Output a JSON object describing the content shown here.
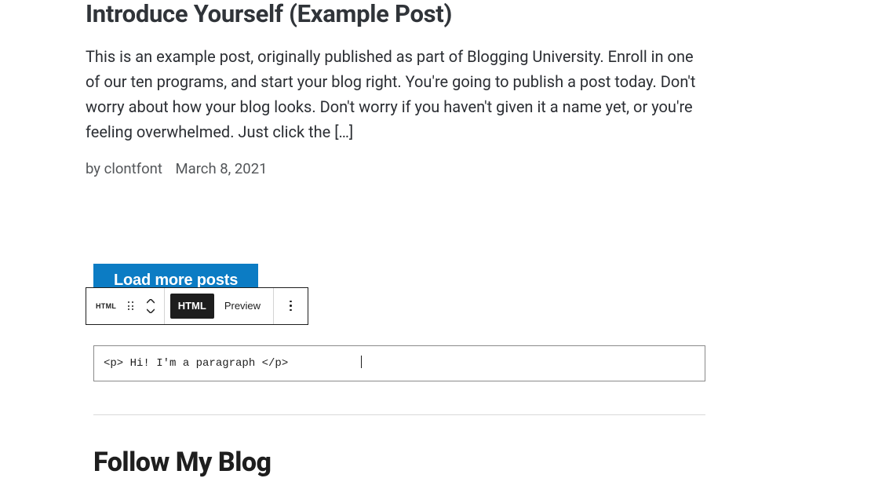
{
  "post": {
    "title": "Introduce Yourself (Example Post)",
    "excerpt": "This is an example post, originally published as part of Blogging University. Enroll in one of our ten programs, and start your blog right. You're going to publish a post today. Don't worry about how your blog looks. Don't worry if you haven't given it a name yet, or you're feeling overwhelmed. Just click the […]",
    "by_prefix": "by ",
    "author": "clontfont",
    "date": "March 8, 2021"
  },
  "load_more_label": "Load more posts",
  "toolbar": {
    "type_label": "HTML",
    "html_tab": "HTML",
    "preview_tab": "Preview"
  },
  "code_value": "<p> Hi! I'm a paragraph </p>",
  "follow_heading": "Follow My Blog"
}
